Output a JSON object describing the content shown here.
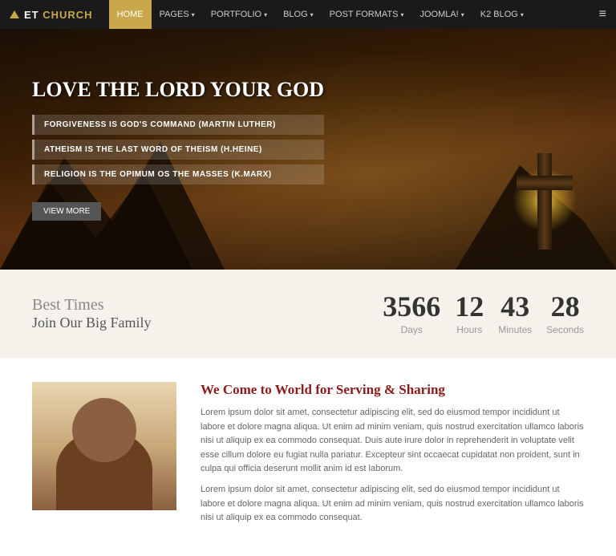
{
  "nav": {
    "logo": {
      "prefix": "ET ",
      "name": "CHURCH"
    },
    "items": [
      {
        "label": "HOME",
        "active": true
      },
      {
        "label": "PAGES",
        "has_arrow": true
      },
      {
        "label": "PORTFOLIO",
        "has_arrow": true
      },
      {
        "label": "BLOG",
        "has_arrow": true
      },
      {
        "label": "POST FORMATS",
        "has_arrow": true
      },
      {
        "label": "JOOMLA!",
        "has_arrow": true
      },
      {
        "label": "K2 BLOG",
        "has_arrow": true
      }
    ]
  },
  "hero": {
    "title": "LOVE THE LORD YOUR GOD",
    "quotes": [
      "FORGIVENESS IS GOD'S COMMAND (Martin Luther)",
      "ATHEISM IS THE LAST WORD OF THEISM (H.Heine)",
      "RELIGION IS THE OPIMUM OS THE MASSES (K.Marx)"
    ],
    "button_label": "View More"
  },
  "countdown": {
    "heading": "Best Times",
    "subheading": "Join Our Big Family",
    "items": [
      {
        "number": "3566",
        "label": "Days"
      },
      {
        "number": "12",
        "label": "Hours"
      },
      {
        "number": "43",
        "label": "Minutes"
      },
      {
        "number": "28",
        "label": "Seconds"
      }
    ]
  },
  "about": {
    "heading": "We Come to World for Serving & Sharing",
    "paragraphs": [
      "Lorem ipsum dolor sit amet, consectetur adipiscing elit, sed do eiusmod tempor incididunt ut labore et dolore magna aliqua. Ut enim ad minim veniam, quis nostrud exercitation ullamco laboris nisi ut aliquip ex ea commodo consequat. Duis aute irure dolor in reprehenderit in voluptate velit esse cillum dolore eu fugiat nulla pariatur. Excepteur sint occaecat cupidatat non proident, sunt in culpa qui officia deserunt mollit anim id est laborum.",
      "Lorem ipsum dolor sit amet, consectetur adipiscing elit, sed do eiusmod tempor incididunt ut labore et dolore magna aliqua. Ut enim ad minim veniam, quis nostrud exercitation ullamco laboris nisi ut aliquip ex ea commodo consequat."
    ]
  }
}
